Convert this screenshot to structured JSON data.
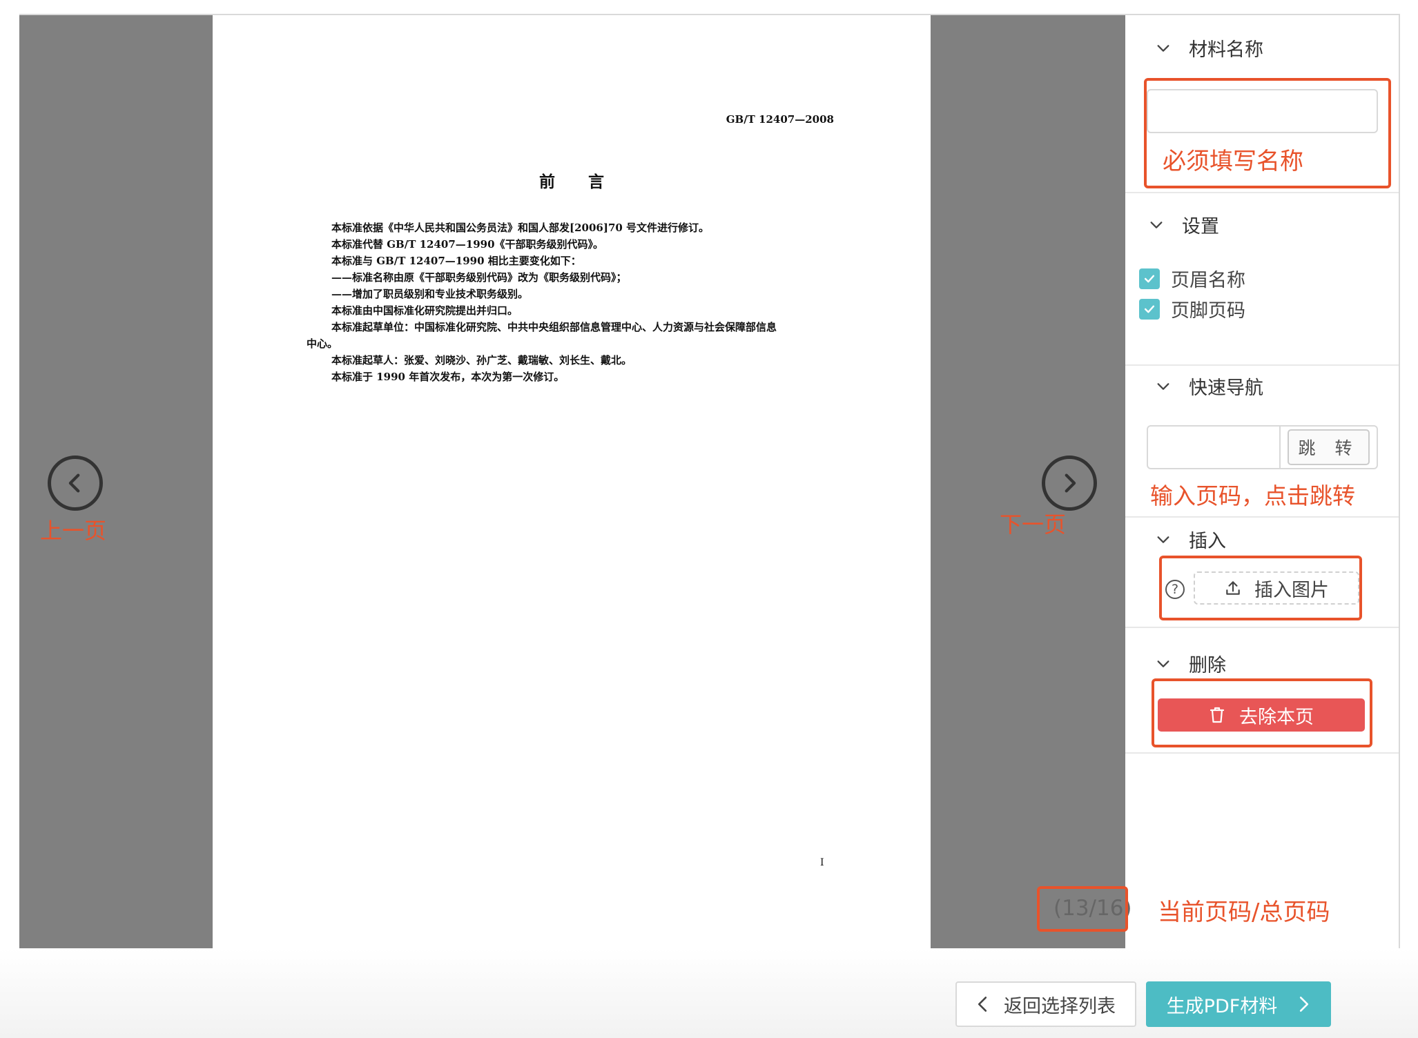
{
  "document": {
    "std_no": "GB/T 12407—2008",
    "title": "前言",
    "paragraphs": [
      {
        "indent": true,
        "text": "本标准依据《中华人民共和国公务员法》和国人部发[2006]70 号文件进行修订。"
      },
      {
        "indent": true,
        "text": "本标准代替 GB/T 12407—1990《干部职务级别代码》。"
      },
      {
        "indent": true,
        "text": "本标准与 GB/T 12407—1990 相比主要变化如下："
      },
      {
        "indent": true,
        "text": "——标准名称由原《干部职务级别代码》改为《职务级别代码》；"
      },
      {
        "indent": true,
        "text": "——增加了职员级别和专业技术职务级别。"
      },
      {
        "indent": true,
        "text": "本标准由中国标准化研究院提出并归口。"
      },
      {
        "indent": true,
        "text": "本标准起草单位：中国标准化研究院、中共中央组织部信息管理中心、人力资源与社会保障部信息"
      },
      {
        "indent": false,
        "text": "中心。"
      },
      {
        "indent": true,
        "text": "本标准起草人：张爱、刘晓沙、孙广芝、戴瑞敏、刘长生、戴北。"
      },
      {
        "indent": true,
        "text": "本标准于 1990 年首次发布，本次为第一次修订。"
      }
    ],
    "page_number": "I"
  },
  "annotations": {
    "prev": "上一页",
    "next": "下一页",
    "name_hint": "必须填写名称",
    "jump_hint": "输入页码，点击跳转",
    "counter_hint": "当前页码/总页码"
  },
  "sidebar": {
    "material_name": {
      "label": "材料名称",
      "value": ""
    },
    "settings": {
      "label": "设置",
      "options": [
        {
          "label": "页眉名称",
          "checked": true
        },
        {
          "label": "页脚页码",
          "checked": true
        }
      ]
    },
    "quick_nav": {
      "label": "快速导航",
      "input_value": "",
      "jump_label": "跳 转"
    },
    "insert": {
      "label": "插入",
      "help": "?",
      "button_label": "插入图片"
    },
    "delete": {
      "label": "删除",
      "button_label": "去除本页"
    }
  },
  "pager": {
    "text": "(13/16)",
    "current": 13,
    "total": 16
  },
  "footer": {
    "back_label": "返回选择列表",
    "generate_label": "生成PDF材料"
  },
  "colors": {
    "annotation": "#e8532b",
    "accent": "#4dbcc4",
    "danger": "#e85656",
    "viewer_bg": "#808080"
  }
}
